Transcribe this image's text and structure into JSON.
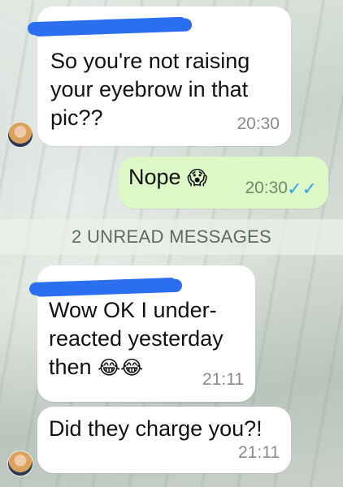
{
  "messages": [
    {
      "text_lines": [
        "So you're not raising",
        "your eyebrow in that",
        "pic??"
      ],
      "time": "20:30"
    },
    {
      "text": "Nope",
      "emoji": "😱",
      "time": "20:30"
    },
    {
      "text_lines": [
        "Wow OK I under-",
        "reacted yesterday",
        "then"
      ],
      "emoji": "😂😂",
      "time": "21:11"
    },
    {
      "text": "Did they charge you?!",
      "time": "21:11"
    }
  ],
  "unread_label": "2 UNREAD MESSAGES",
  "colors": {
    "incoming": "#ffffff",
    "outgoing": "#dcf8c6",
    "read_ticks": "#3aa0ea",
    "redaction": "#2b6ff0"
  }
}
